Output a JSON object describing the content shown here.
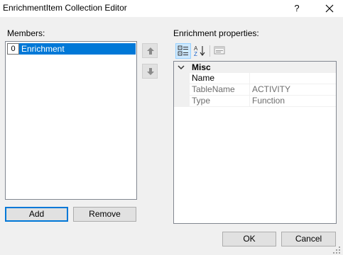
{
  "window": {
    "title": "EnrichmentItem Collection Editor",
    "help_label": "?"
  },
  "members": {
    "label": "Members:",
    "items": [
      {
        "index": "0",
        "name": "Enrichment",
        "selected": true
      }
    ]
  },
  "buttons": {
    "add": "Add",
    "remove": "Remove",
    "ok": "OK",
    "cancel": "Cancel"
  },
  "properties": {
    "label": "Enrichment properties:",
    "toolbar": [
      "categorized-icon",
      "alphabetical-icon",
      "property-pages-icon"
    ],
    "category": "Misc",
    "rows": [
      {
        "name": "Name",
        "value": "",
        "readonly": false
      },
      {
        "name": "TableName",
        "value": "ACTIVITY",
        "readonly": true
      },
      {
        "name": "Type",
        "value": "Function",
        "readonly": true
      }
    ]
  },
  "colors": {
    "selection": "#0078d7",
    "dialog_bg": "#f0f0f0",
    "readonly_text": "#6d6d6d"
  }
}
